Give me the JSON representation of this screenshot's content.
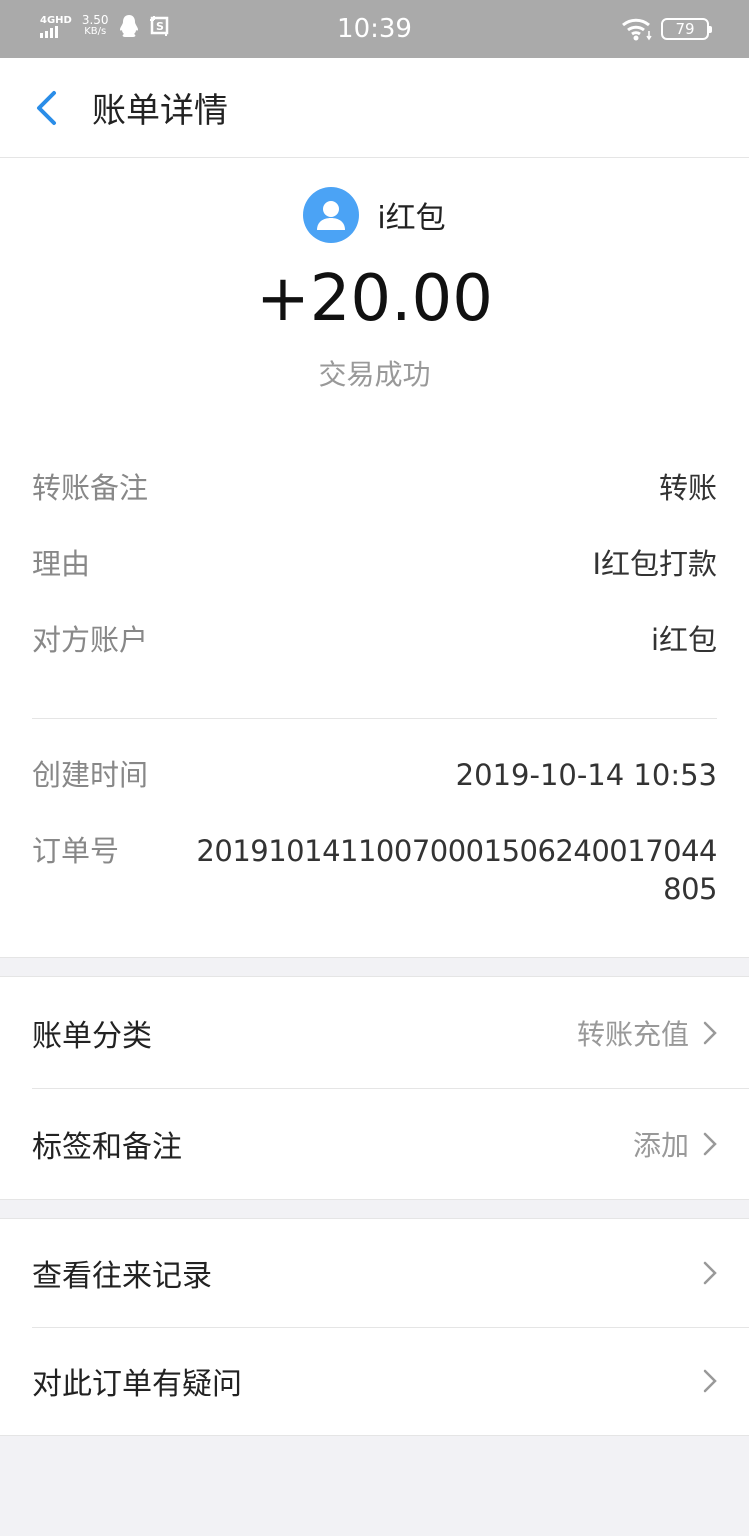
{
  "status_bar": {
    "network": "4GHD",
    "speed": "3.50",
    "speed_unit": "KB/s",
    "time": "10:39",
    "battery": "79"
  },
  "nav": {
    "title": "账单详情",
    "back_icon": "chevron-left-icon"
  },
  "header": {
    "payee_name": "i红包",
    "avatar_icon": "user-avatar-icon",
    "amount": "+20.00",
    "status": "交易成功"
  },
  "details": [
    {
      "label": "转账备注",
      "value": "转账"
    },
    {
      "label": "理由",
      "value": "I红包打款"
    },
    {
      "label": "对方账户",
      "value": "i红包"
    }
  ],
  "meta": [
    {
      "label": "创建时间",
      "value": "2019-10-14 10:53"
    },
    {
      "label": "订单号",
      "value": "20191014110070001506240017044805"
    }
  ],
  "settings": [
    {
      "label": "账单分类",
      "value": "转账充值"
    },
    {
      "label": "标签和备注",
      "value": "添加"
    }
  ],
  "actions": [
    {
      "label": "查看往来记录"
    },
    {
      "label": "对此订单有疑问"
    }
  ],
  "colors": {
    "accent": "#2a8de8",
    "avatar_bg": "#4ba3f5",
    "page_bg": "#f2f2f5"
  }
}
